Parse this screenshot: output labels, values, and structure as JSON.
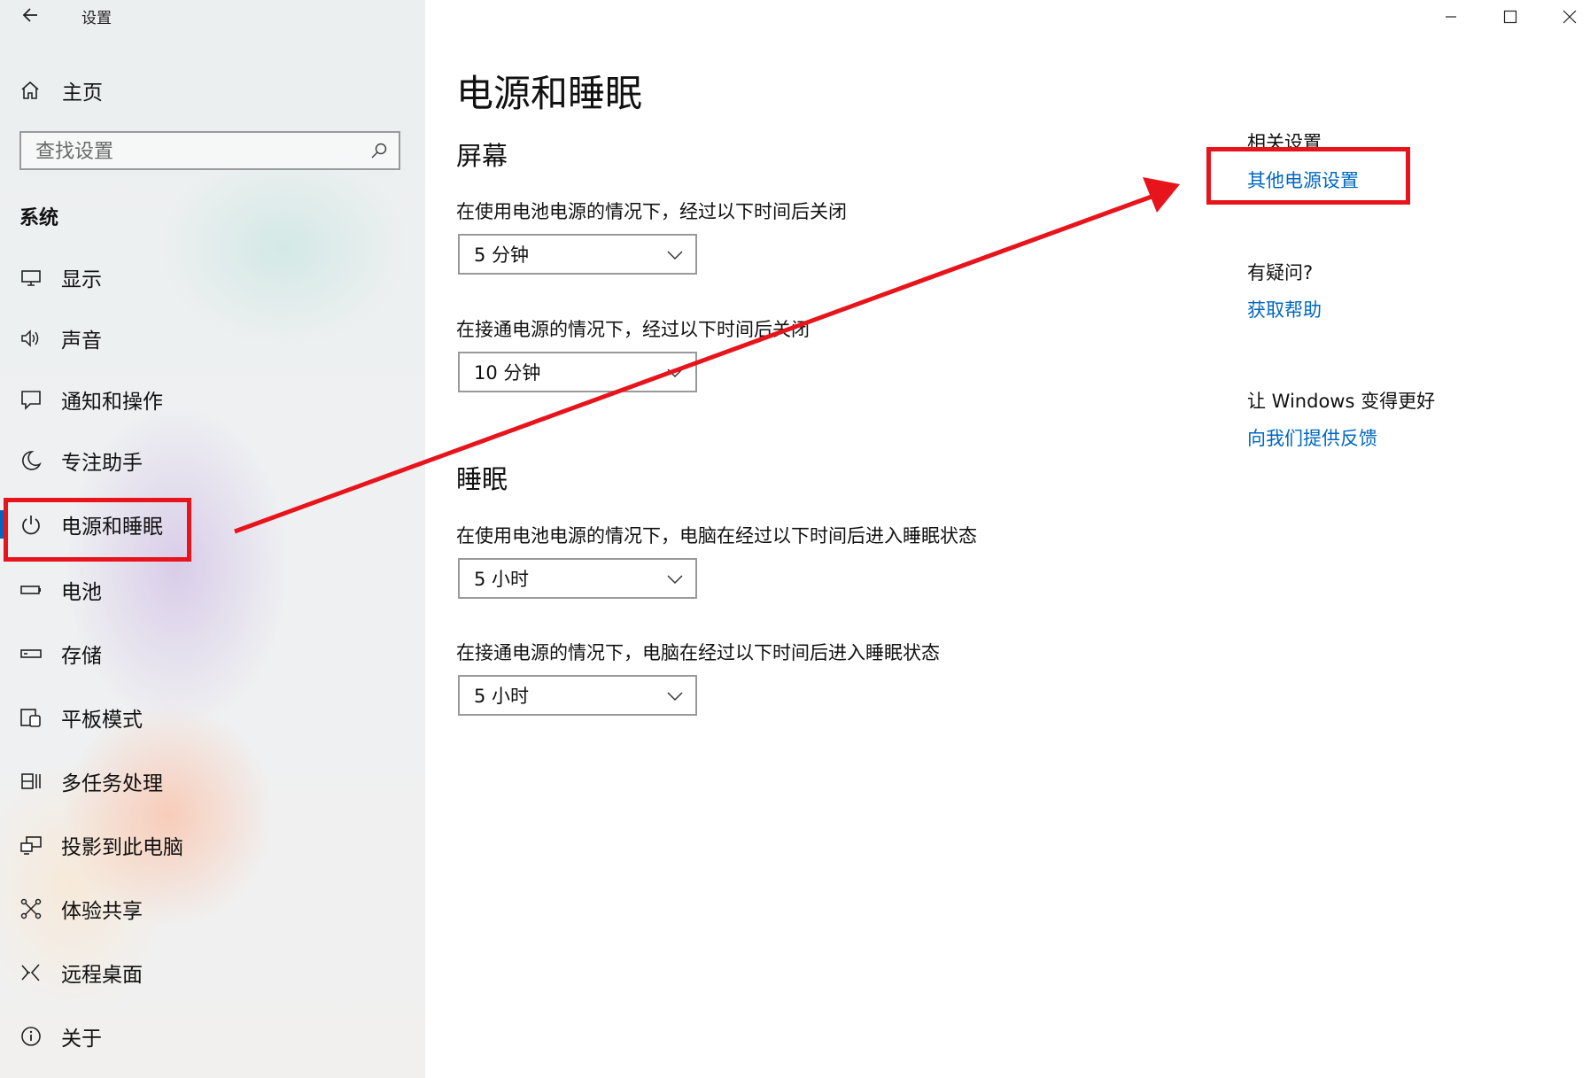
{
  "window": {
    "title": "设置",
    "controls": {
      "minimize": "minimize-icon",
      "maximize": "maximize-icon",
      "close": "close-icon"
    }
  },
  "sidebar": {
    "home_label": "主页",
    "search_placeholder": "查找设置",
    "group_label": "系统",
    "items": [
      {
        "label": "显示",
        "icon": "display-icon"
      },
      {
        "label": "声音",
        "icon": "speaker-icon"
      },
      {
        "label": "通知和操作",
        "icon": "notification-icon"
      },
      {
        "label": "专注助手",
        "icon": "moon-icon"
      },
      {
        "label": "电源和睡眠",
        "icon": "power-icon",
        "active": true
      },
      {
        "label": "电池",
        "icon": "battery-icon"
      },
      {
        "label": "存储",
        "icon": "storage-icon"
      },
      {
        "label": "平板模式",
        "icon": "tablet-icon"
      },
      {
        "label": "多任务处理",
        "icon": "multitask-icon"
      },
      {
        "label": "投影到此电脑",
        "icon": "project-icon"
      },
      {
        "label": "体验共享",
        "icon": "share-icon"
      },
      {
        "label": "远程桌面",
        "icon": "remote-desktop-icon"
      },
      {
        "label": "关于",
        "icon": "info-icon"
      }
    ]
  },
  "main": {
    "title": "电源和睡眠",
    "screen": {
      "title": "屏幕",
      "battery_label": "在使用电池电源的情况下，经过以下时间后关闭",
      "battery_value": "5 分钟",
      "plugged_label": "在接通电源的情况下，经过以下时间后关闭",
      "plugged_value": "10 分钟"
    },
    "sleep": {
      "title": "睡眠",
      "battery_label": "在使用电池电源的情况下，电脑在经过以下时间后进入睡眠状态",
      "battery_value": "5 小时",
      "plugged_label": "在接通电源的情况下，电脑在经过以下时间后进入睡眠状态",
      "plugged_value": "5 小时"
    }
  },
  "related": {
    "heading": "相关设置",
    "link": "其他电源设置",
    "help_heading": "有疑问?",
    "help_link": "获取帮助",
    "feedback_heading": "让 Windows 变得更好",
    "feedback_link": "向我们提供反馈"
  },
  "colors": {
    "accent": "#0067c0",
    "annotation": "#e8141c"
  }
}
